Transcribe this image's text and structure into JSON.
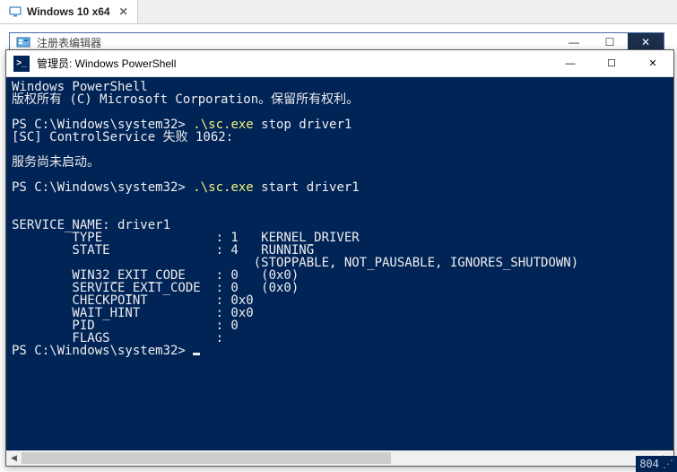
{
  "vm_tab": {
    "label": "Windows 10 x64"
  },
  "regedit": {
    "title": "注册表编辑器"
  },
  "powershell": {
    "title": "管理员: Windows PowerShell",
    "icon_glyph": ">_",
    "minimize_glyph": "—",
    "maximize_glyph": "☐",
    "close_glyph": "✕",
    "banner1": "Windows PowerShell",
    "banner2": "版权所有 (C) Microsoft Corporation。保留所有权利。",
    "prompt": "PS C:\\Windows\\system32> ",
    "cmd_stop_exe": ".\\sc.exe",
    "cmd_stop_args": " stop driver1",
    "stop_err1": "[SC] ControlService 失败 1062:",
    "stop_err2": "服务尚未启动。",
    "cmd_start_exe": ".\\sc.exe",
    "cmd_start_args": " start driver1",
    "svc_name_line": "SERVICE_NAME: driver1",
    "row_type": "        TYPE               : 1   KERNEL_DRIVER",
    "row_state": "        STATE              : 4   RUNNING",
    "row_state2": "                                (STOPPABLE, NOT_PAUSABLE, IGNORES_SHUTDOWN)",
    "row_win32": "        WIN32_EXIT_CODE    : 0   (0x0)",
    "row_svcexit": "        SERVICE_EXIT_CODE  : 0   (0x0)",
    "row_checkpoint": "        CHECKPOINT         : 0x0",
    "row_waithint": "        WAIT_HINT          : 0x0",
    "row_pid": "        PID                : 0",
    "row_flags": "        FLAGS              :"
  },
  "scroll": {
    "left_glyph": "◀",
    "right_glyph": "▶"
  },
  "status": {
    "value": "804"
  }
}
